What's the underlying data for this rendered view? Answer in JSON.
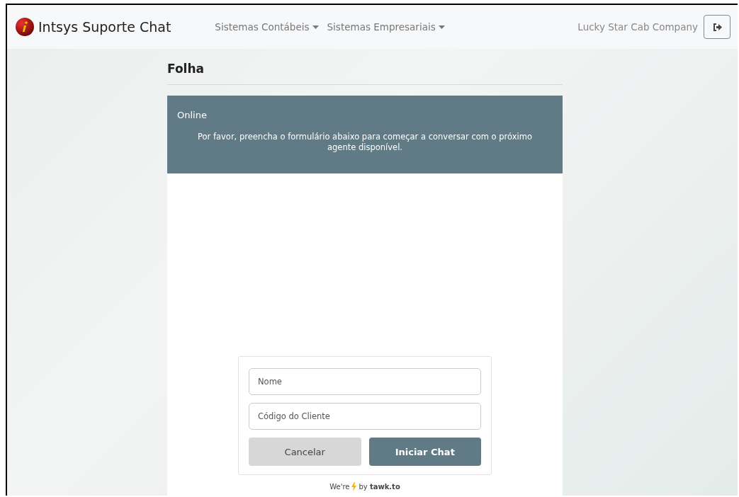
{
  "navbar": {
    "brand": "Intsys Suporte Chat",
    "menus": [
      {
        "label": "Sistemas Contábeis"
      },
      {
        "label": "Sistemas Empresariais"
      }
    ],
    "company": "Lucky Star Cab Company"
  },
  "page": {
    "title": "Folha"
  },
  "chat": {
    "status": "Online",
    "message": "Por favor, preencha o formulário abaixo para começar a conversar com o próximo agente disponível.",
    "fields": [
      {
        "placeholder": "Nome"
      },
      {
        "placeholder": "Código do Cliente"
      }
    ],
    "buttons": [
      {
        "label": "Cancelar",
        "kind": "secondary"
      },
      {
        "label": "Iniciar Chat",
        "kind": "primary"
      }
    ],
    "footer": {
      "prefix": "We're",
      "suffix": "by **tawk.to**"
    }
  }
}
